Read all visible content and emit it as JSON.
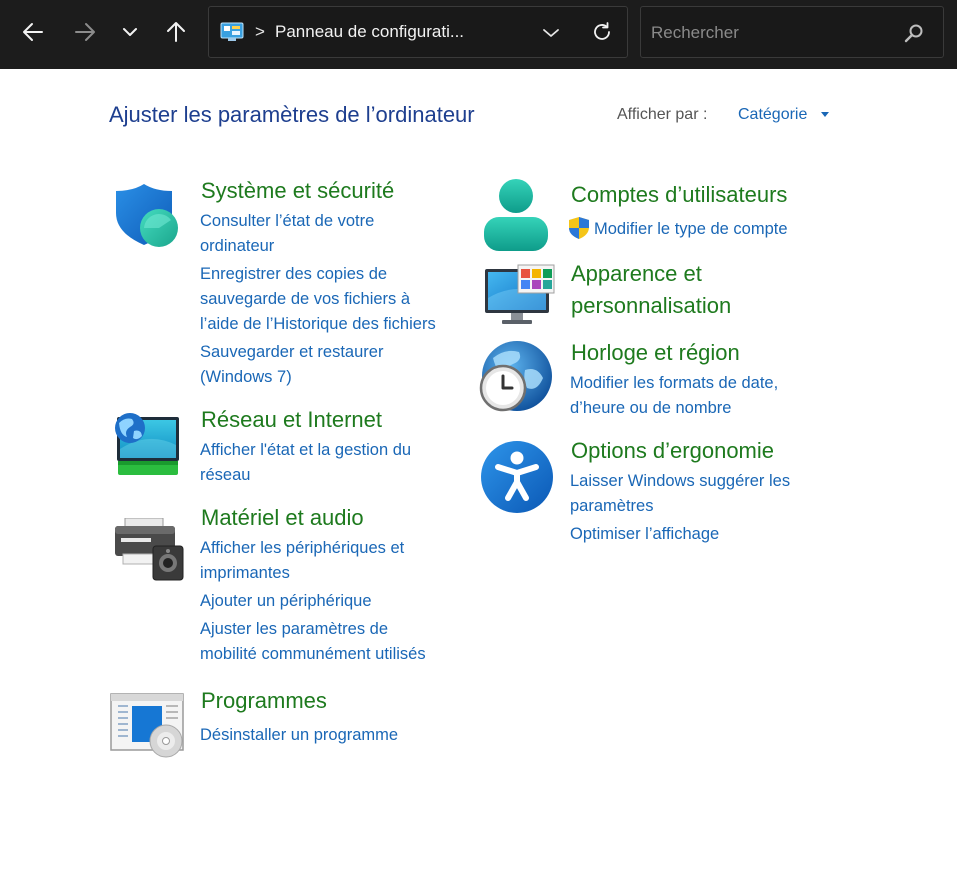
{
  "nav": {
    "address_text": "Panneau de configurati...",
    "address_separator": ">",
    "search_placeholder": "Rechercher"
  },
  "header": {
    "title": "Ajuster les paramètres de l’ordinateur",
    "view_by_label": "Afficher par :",
    "view_by_value": "Catégorie"
  },
  "categories": {
    "system": {
      "title": "Système et sécurité",
      "links": [
        [
          "Consulter l’état de votre",
          "ordinateur"
        ],
        [
          "Enregistrer des copies de",
          "sauvegarde de vos fichiers à",
          "l’aide de l’Historique des fichiers"
        ],
        [
          "Sauvegarder et restaurer",
          "(Windows 7)"
        ]
      ]
    },
    "network": {
      "title": "Réseau et Internet",
      "links": [
        [
          "Afficher l'état et la gestion du",
          "réseau"
        ]
      ]
    },
    "hardware": {
      "title": "Matériel et audio",
      "links": [
        [
          "Afficher les périphériques et",
          "imprimantes"
        ],
        [
          "Ajouter un périphérique"
        ],
        [
          "Ajuster les paramètres de",
          "mobilité communément utilisés"
        ]
      ]
    },
    "programs": {
      "title": "Programmes",
      "links": [
        [
          "Désinstaller un programme"
        ]
      ]
    },
    "accounts": {
      "title": "Comptes d’utilisateurs",
      "links": [
        [
          "Modifier le type de compte"
        ]
      ]
    },
    "appearance": {
      "title_lines": [
        "Apparence et",
        "personnalisation"
      ]
    },
    "clock": {
      "title": "Horloge et région",
      "links": [
        [
          "Modifier les formats de date,",
          "d’heure ou de nombre"
        ]
      ]
    },
    "ease": {
      "title": "Options d’ergonomie",
      "links": [
        [
          "Laisser Windows suggérer les",
          "paramètres"
        ],
        [
          "Optimiser l’affichage"
        ]
      ]
    }
  },
  "colors": {
    "nav_background": "#1c1c1c",
    "title_blue": "#1e3f8f",
    "category_green": "#1e7a1e",
    "link_blue": "#1a67b6"
  }
}
